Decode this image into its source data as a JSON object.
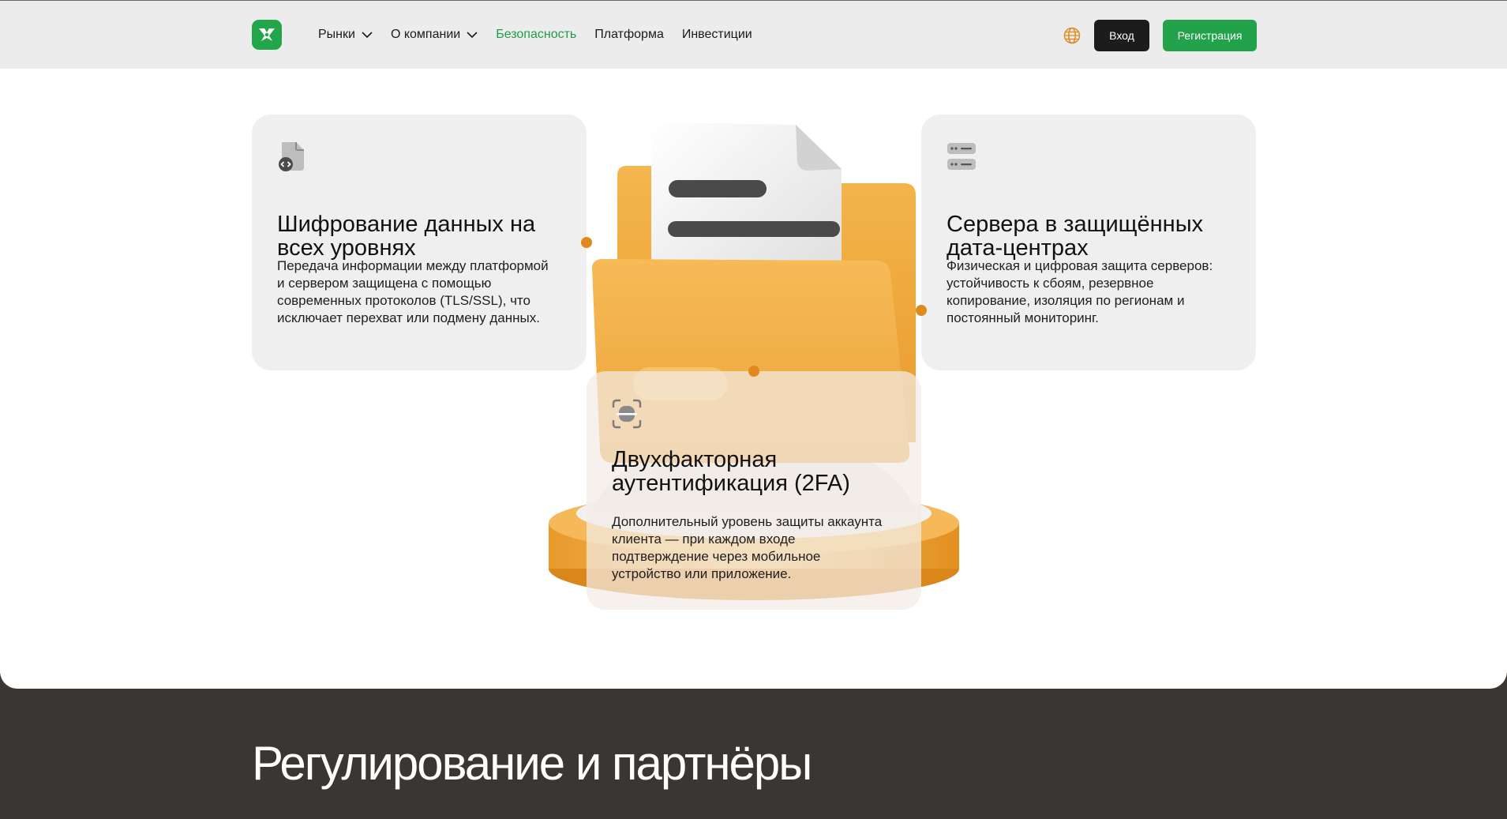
{
  "header": {
    "nav": [
      {
        "label": "Рынки",
        "dropdown": true
      },
      {
        "label": "О компании",
        "dropdown": true
      },
      {
        "label": "Безопасность",
        "active": true
      },
      {
        "label": "Платформа"
      },
      {
        "label": "Инвестиции"
      }
    ],
    "login_label": "Вход",
    "register_label": "Регистрация",
    "icons": {
      "logo": "brand-logo-icon",
      "language": "globe-icon",
      "dropdown": "chevron-down-icon"
    }
  },
  "features": [
    {
      "title": "Шифрование данных на всех уровнях",
      "text": "Передача информации между платформой и сервером защищена с помощью современных протоколов (TLS/SSL), что исключает перехват или подмену данных.",
      "icon": "encrypted-file-icon"
    },
    {
      "title": "Сервера в защищённых дата-центрах",
      "text": "Физическая и цифровая защита серверов: устойчивость к сбоям, резервное копирование, изоляция по регионам и постоянный мониторинг.",
      "icon": "server-icon"
    },
    {
      "title": "Двухфакторная аутентификация (2FA)",
      "text": "Дополнительный уровень защиты аккаунта клиента — при каждом входе подтверждение через мобильное устройство или приложение.",
      "icon": "face-scan-icon"
    }
  ],
  "footer": {
    "heading": "Регулирование и партнёры"
  },
  "colors": {
    "brand_green": "#23a64a",
    "accent_orange": "#e08a1e",
    "dark": "#3a3633"
  }
}
